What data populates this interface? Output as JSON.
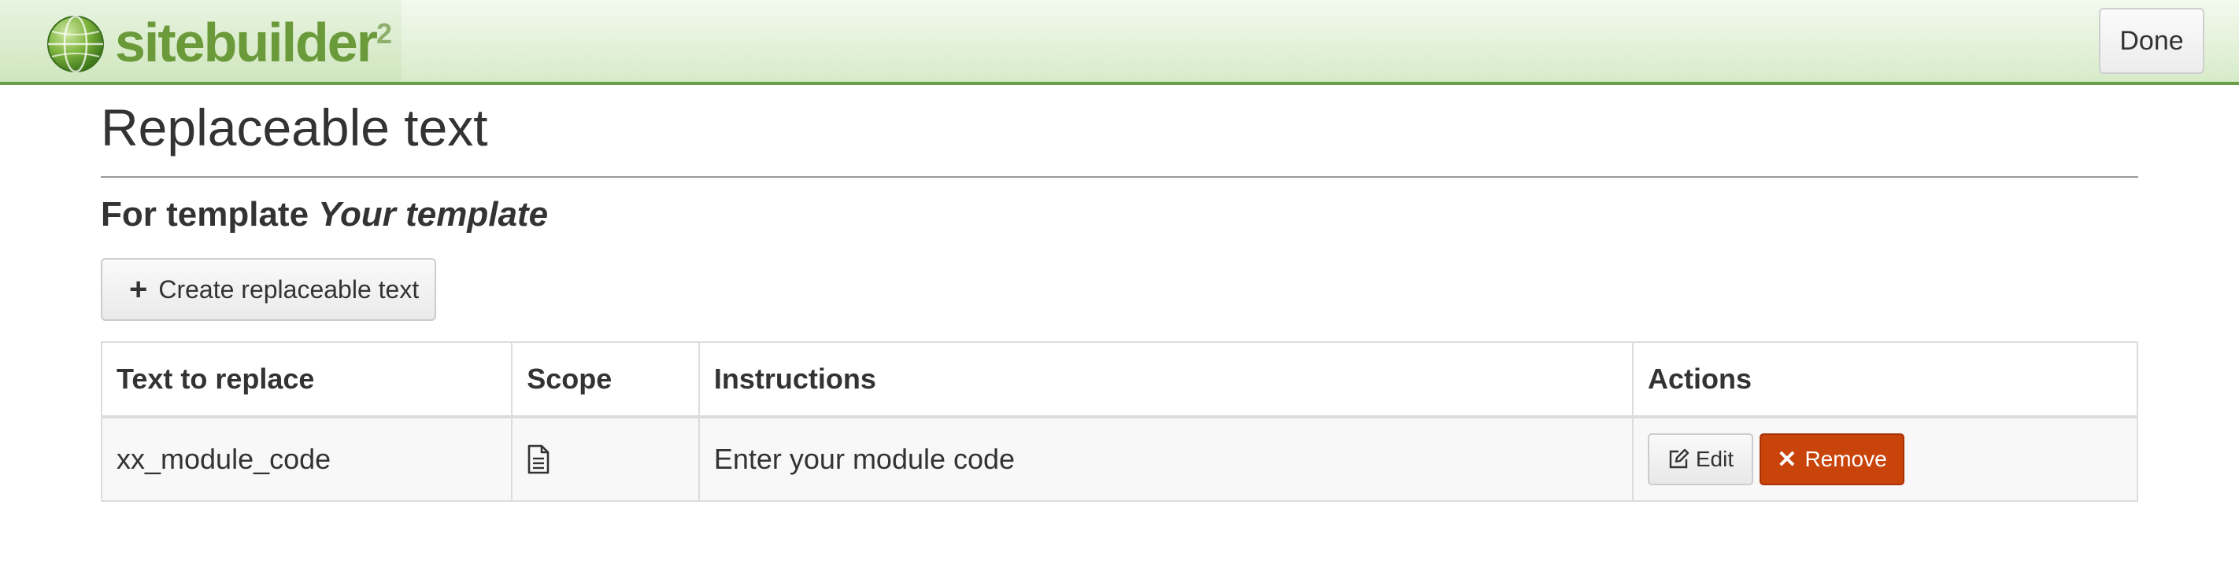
{
  "header": {
    "logo_text": "sitebuilder",
    "logo_sup": "2",
    "done_label": "Done"
  },
  "page": {
    "title": "Replaceable text",
    "subtitle_prefix": "For template ",
    "subtitle_template": "Your template",
    "create_label": "Create replaceable text"
  },
  "table": {
    "headers": [
      "Text to replace",
      "Scope",
      "Instructions",
      "Actions"
    ],
    "rows": [
      {
        "text": "xx_module_code",
        "scope_icon": "document-icon",
        "instructions": "Enter your module code",
        "edit_label": "Edit",
        "remove_label": "Remove"
      }
    ]
  },
  "colors": {
    "header_green": "#d6ebc8",
    "remove_button": "#c9440b",
    "logo_green": "#6a9a3a"
  }
}
